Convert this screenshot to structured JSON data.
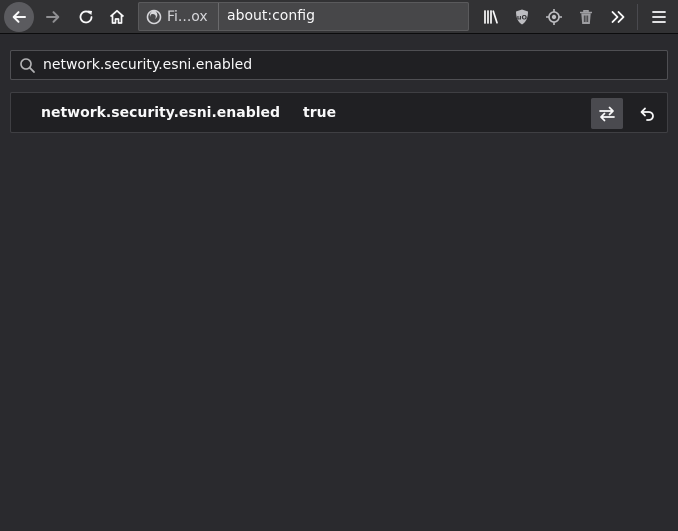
{
  "browser": {
    "identity_label": "Fi...ox",
    "url": "about:config"
  },
  "toolbar": {
    "back": "back-arrow-icon",
    "forward": "forward-arrow-icon",
    "reload": "reload-icon",
    "home": "home-icon",
    "library": "library-icon",
    "ublock": "ublock-origin-icon",
    "target": "crosshair-icon",
    "trash": "trash-icon",
    "overflow": "chevron-double-right-icon",
    "menu": "hamburger-menu-icon"
  },
  "search": {
    "value": "network.security.esni.enabled"
  },
  "preferences": [
    {
      "name": "network.security.esni.enabled",
      "value": "true"
    }
  ],
  "colors": {
    "background": "#2a2a2e",
    "toolbar": "#323234",
    "urlbar": "#474749",
    "row": "#202023",
    "toggle_button": "#4a4a4f"
  }
}
